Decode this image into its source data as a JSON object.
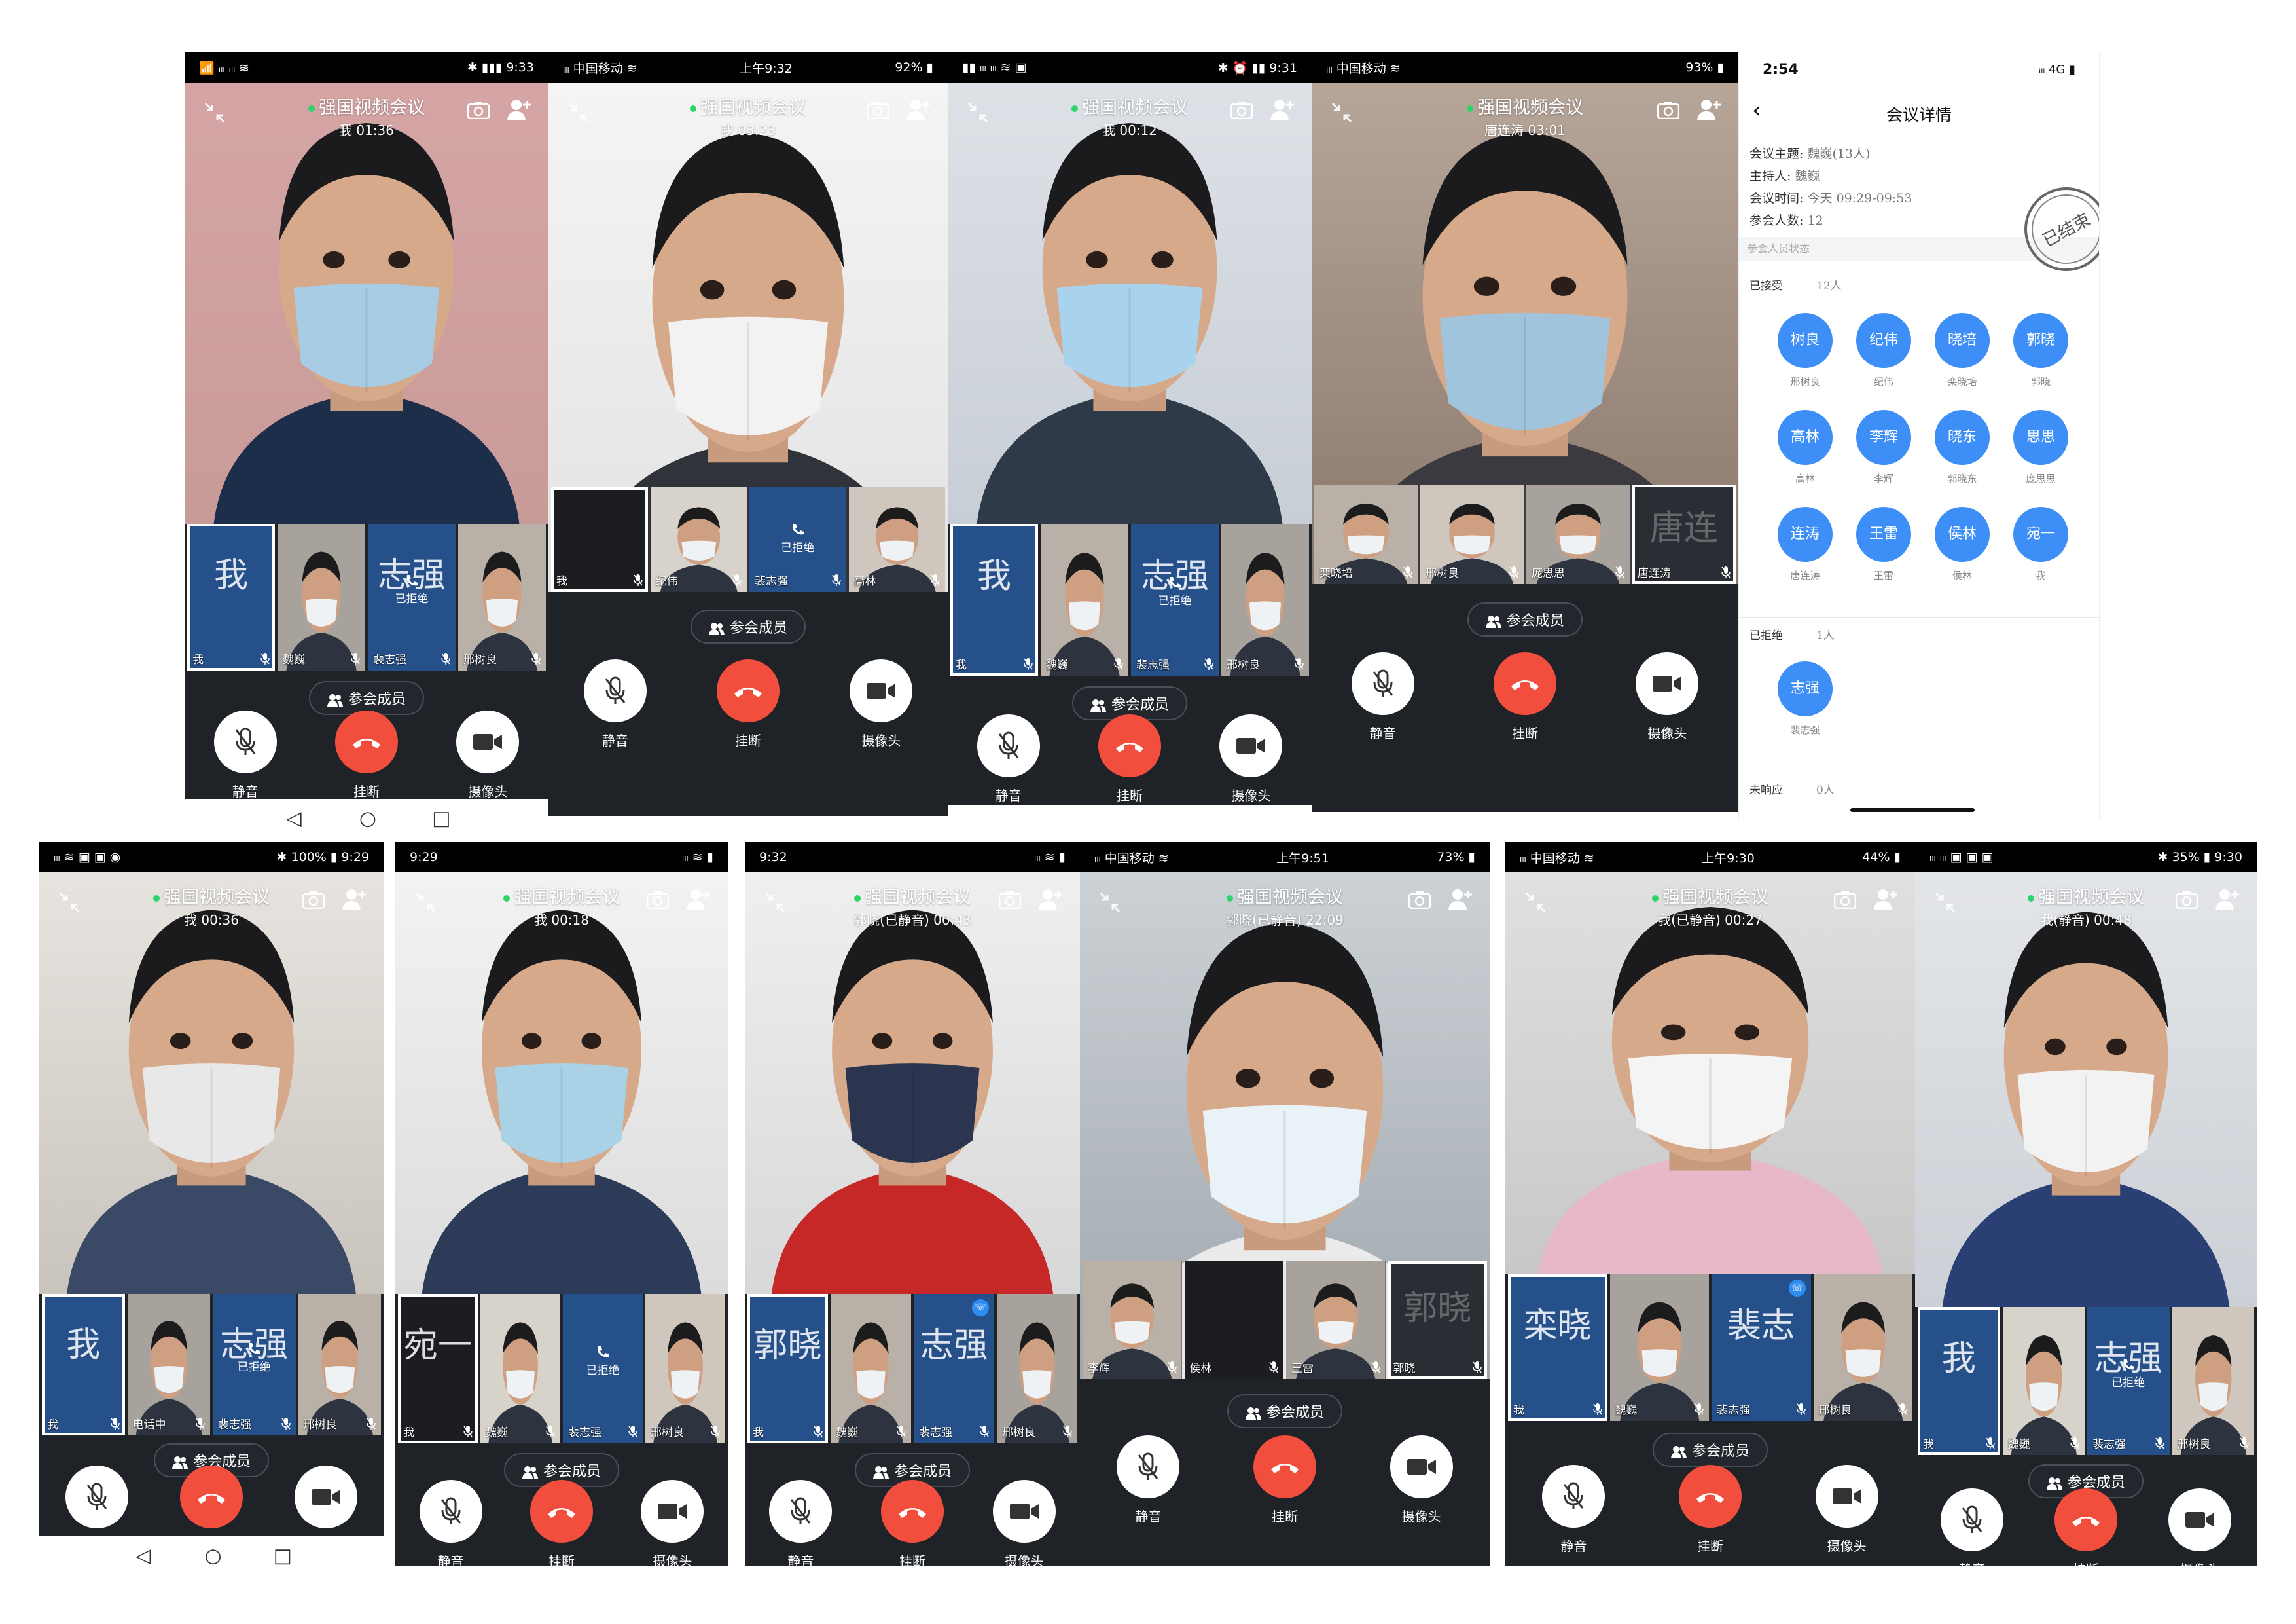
{
  "common": {
    "title": "强国视频会议",
    "members_label": "参会成员",
    "mute_label": "静音",
    "hangup_label": "挂断",
    "camera_label": "摄像头",
    "rejected_label": "已拒绝",
    "colors": {
      "hangup": "#f24e3e",
      "avatar": "#3e8ef7",
      "online_dot": "#2ed36b",
      "tile_blue": "#25508a"
    }
  },
  "phones": [
    {
      "id": "p1",
      "status": {
        "left": "📶 ᵢₗₗ ᵢₗₗ ≋",
        "center": "",
        "right": "✱ ▮▮▮ 9:33"
      },
      "sub": "我 01:36",
      "thumbs": [
        {
          "big": "我",
          "name": "我",
          "style": "blue sel"
        },
        {
          "big": "",
          "name": "魏巍",
          "style": "face"
        },
        {
          "big": "志强",
          "name": "裴志强",
          "style": "blue rej"
        },
        {
          "big": "",
          "name": "邢树良",
          "style": "face"
        }
      ],
      "nav": {
        "back": "◁",
        "home": "○",
        "recent": "□"
      }
    },
    {
      "id": "p2",
      "status": {
        "left": "ᵢₗₗ 中国移动 ≋",
        "center": "上午9:32",
        "right": "92% ▮"
      },
      "sub": "我 03:23",
      "thumbs": [
        {
          "big": "",
          "name": "我",
          "style": "dark sel"
        },
        {
          "big": "",
          "name": "纪伟",
          "style": "face"
        },
        {
          "big": "",
          "name": "裴志强",
          "style": "blue rej"
        },
        {
          "big": "",
          "name": "高林",
          "style": "face"
        }
      ]
    },
    {
      "id": "p3",
      "status": {
        "left": "▮▮ ᵢₗₗ ᵢₗₗ ≋ ▣",
        "center": "",
        "right": "✱ ⏰ ▮▮ 9:31"
      },
      "sub": "我 00:12",
      "thumbs": [
        {
          "big": "我",
          "name": "我",
          "style": "blue sel"
        },
        {
          "big": "",
          "name": "魏巍",
          "style": "face"
        },
        {
          "big": "志强",
          "name": "裴志强",
          "style": "blue rej"
        },
        {
          "big": "",
          "name": "邢树良",
          "style": "face"
        }
      ]
    },
    {
      "id": "p4",
      "status": {
        "left": "ᵢₗₗ 中国移动 ≋",
        "center": "",
        "right": "93% ▮"
      },
      "sub": "唐连涛 03:01",
      "thumbs": [
        {
          "big": "",
          "name": "栾晓培",
          "style": "face"
        },
        {
          "big": "",
          "name": "邢树良",
          "style": "face"
        },
        {
          "big": "",
          "name": "庞思思",
          "style": "face"
        },
        {
          "big": "唐连",
          "name": "唐连涛",
          "style": "blur sel"
        }
      ]
    },
    {
      "id": "p5",
      "status": {
        "left": "ᵢₗₗ ≋ ▣ ▣ ◉",
        "center": "",
        "right": "✱ 100% ▮ 9:29"
      },
      "sub": "我 00:36",
      "thumbs": [
        {
          "big": "我",
          "name": "我",
          "style": "blue sel"
        },
        {
          "big": "",
          "name": "电话中",
          "style": "face"
        },
        {
          "big": "志强",
          "name": "裴志强",
          "style": "blue rej"
        },
        {
          "big": "",
          "name": "邢树良",
          "style": "face"
        }
      ],
      "nav": {
        "back": "◁",
        "home": "○",
        "recent": "□"
      }
    },
    {
      "id": "p6",
      "status": {
        "left": "9:29",
        "center": "",
        "right": "ᵢₗₗ ≋ ▮"
      },
      "sub": "我 00:18",
      "thumbs": [
        {
          "big": "宛一",
          "name": "我",
          "style": "dark sel"
        },
        {
          "big": "",
          "name": "魏巍",
          "style": "face"
        },
        {
          "big": "",
          "name": "裴志强",
          "style": "blue rej"
        },
        {
          "big": "",
          "name": "邢树良",
          "style": "face"
        }
      ]
    },
    {
      "id": "p7",
      "status": {
        "left": "9:32",
        "center": "",
        "right": "ᵢₗₗ ≋ ▮"
      },
      "sub": "郭晓(已静音) 00:43",
      "thumbs": [
        {
          "big": "郭晓",
          "name": "我",
          "style": "blue sel"
        },
        {
          "big": "",
          "name": "魏巍",
          "style": "face"
        },
        {
          "big": "志强",
          "name": "裴志强",
          "style": "blue tag"
        },
        {
          "big": "",
          "name": "邢树良",
          "style": "face"
        }
      ]
    },
    {
      "id": "p8",
      "status": {
        "left": "ᵢₗₗ 中国移动 ≋",
        "center": "上午9:51",
        "right": "73% ▮"
      },
      "sub": "郭晓(已静音) 22:09",
      "thumbs": [
        {
          "big": "",
          "name": "李辉",
          "style": "face"
        },
        {
          "big": "",
          "name": "侯林",
          "style": "dark"
        },
        {
          "big": "",
          "name": "王雷",
          "style": "face"
        },
        {
          "big": "郭晓",
          "name": "郭晓",
          "style": "blur sel"
        }
      ]
    },
    {
      "id": "p9",
      "status": {
        "left": "ᵢₗₗ 中国移动 ≋",
        "center": "上午9:30",
        "right": "44% ▮"
      },
      "sub": "我(已静音) 00:27",
      "thumbs": [
        {
          "big": "栾晓",
          "name": "我",
          "style": "blue sel"
        },
        {
          "big": "",
          "name": "魏巍",
          "style": "face"
        },
        {
          "big": "裴志",
          "name": "裴志强",
          "style": "blue tag"
        },
        {
          "big": "",
          "name": "邢树良",
          "style": "face"
        }
      ]
    },
    {
      "id": "p10",
      "status": {
        "left": "ᵢₗₗ ᵢₗₗ ▣ ▣ ▣",
        "center": "",
        "right": "✱ 35% ▮ 9:30"
      },
      "sub": "我(静音) 00:48",
      "thumbs": [
        {
          "big": "我",
          "name": "我",
          "style": "blue sel"
        },
        {
          "big": "",
          "name": "魏巍",
          "style": "face"
        },
        {
          "big": "志强",
          "name": "裴志强",
          "style": "blue rej"
        },
        {
          "big": "",
          "name": "邢树良",
          "style": "face"
        }
      ]
    }
  ],
  "detail": {
    "status_time": "2:54",
    "status_right": "ᵢₗₗ 4G ▮",
    "back": "‹",
    "title": "会议详情",
    "topic_k": "会议主题: ",
    "topic_v": "魏巍(13人)",
    "host_k": "主持人: ",
    "host_v": "魏巍",
    "time_k": "会议时间: ",
    "time_v": "今天 09:29-09:53",
    "count_k": "参会人数: ",
    "count_v": "12",
    "hint": "参会人员状态",
    "stamp": "已结束",
    "accepted_label": "已接受",
    "accepted_count": "12人",
    "accepted": [
      {
        "a": "树良",
        "n": "邢树良"
      },
      {
        "a": "纪伟",
        "n": "纪伟"
      },
      {
        "a": "晓培",
        "n": "栾晓培"
      },
      {
        "a": "郭晓",
        "n": "郭晓"
      },
      {
        "a": "高林",
        "n": "高林"
      },
      {
        "a": "李辉",
        "n": "李辉"
      },
      {
        "a": "晓东",
        "n": "郭晓东"
      },
      {
        "a": "思思",
        "n": "庞思思"
      },
      {
        "a": "连涛",
        "n": "唐连涛"
      },
      {
        "a": "王雷",
        "n": "王雷"
      },
      {
        "a": "侯林",
        "n": "侯林"
      },
      {
        "a": "宛一",
        "n": "我"
      }
    ],
    "rejected_label": "已拒绝",
    "rejected_count": "1人",
    "rejected": [
      {
        "a": "志强",
        "n": "裴志强"
      }
    ],
    "noresp_label": "未响应",
    "noresp_count": "0人"
  }
}
